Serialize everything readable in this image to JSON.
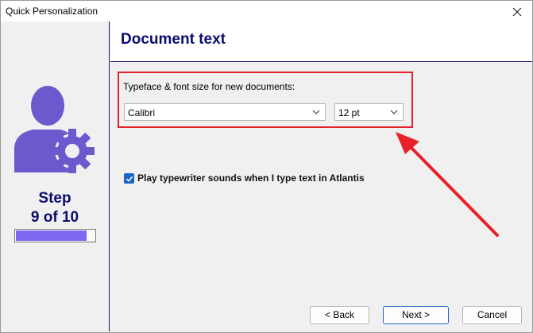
{
  "window": {
    "title": "Quick Personalization"
  },
  "sidebar": {
    "step_word": "Step",
    "step_count": "9 of 10",
    "progress": 0.9
  },
  "header": {
    "title": "Document text"
  },
  "font_group": {
    "label": "Typeface & font size for new documents:",
    "typeface": "Calibri",
    "size": "12 pt"
  },
  "option": {
    "label": "Play typewriter sounds when I type text in Atlantis",
    "checked": true
  },
  "buttons": {
    "back": "< Back",
    "next": "Next >",
    "cancel": "Cancel"
  },
  "colors": {
    "accent": "#0c0c6e",
    "icon": "#6a5acd",
    "highlight": "#e8202a",
    "progress": "#7b68ee"
  }
}
